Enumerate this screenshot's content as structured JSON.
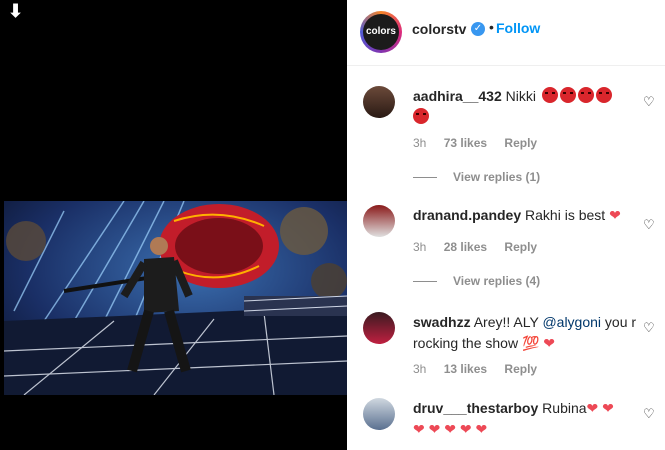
{
  "post": {
    "download_icon": "down-arrow-icon"
  },
  "header": {
    "logo_text": "colors",
    "username": "colorstv",
    "dot": "•",
    "follow_label": "Follow"
  },
  "comments": [
    {
      "username": "aadhira__432",
      "text": "Nikki",
      "time": "3h",
      "likes": "73 likes",
      "reply": "Reply",
      "view_replies": "View replies (1)"
    },
    {
      "username": "dranand.pandey",
      "text": "Rakhi is best",
      "time": "3h",
      "likes": "28 likes",
      "reply": "Reply",
      "view_replies": "View replies (4)"
    },
    {
      "username": "swadhzz",
      "text_before": "Arey!! ALY",
      "mention": "@alygoni",
      "text_after": "you r rocking the show",
      "time": "3h",
      "likes": "13 likes",
      "reply": "Reply"
    },
    {
      "username": "druv___thestarboy",
      "text": "Rubina"
    }
  ],
  "colors": {
    "follow": "#0095f6",
    "heart": "#ed4956",
    "secondary_text": "#8e8e8e",
    "media_bg": "#000000"
  }
}
